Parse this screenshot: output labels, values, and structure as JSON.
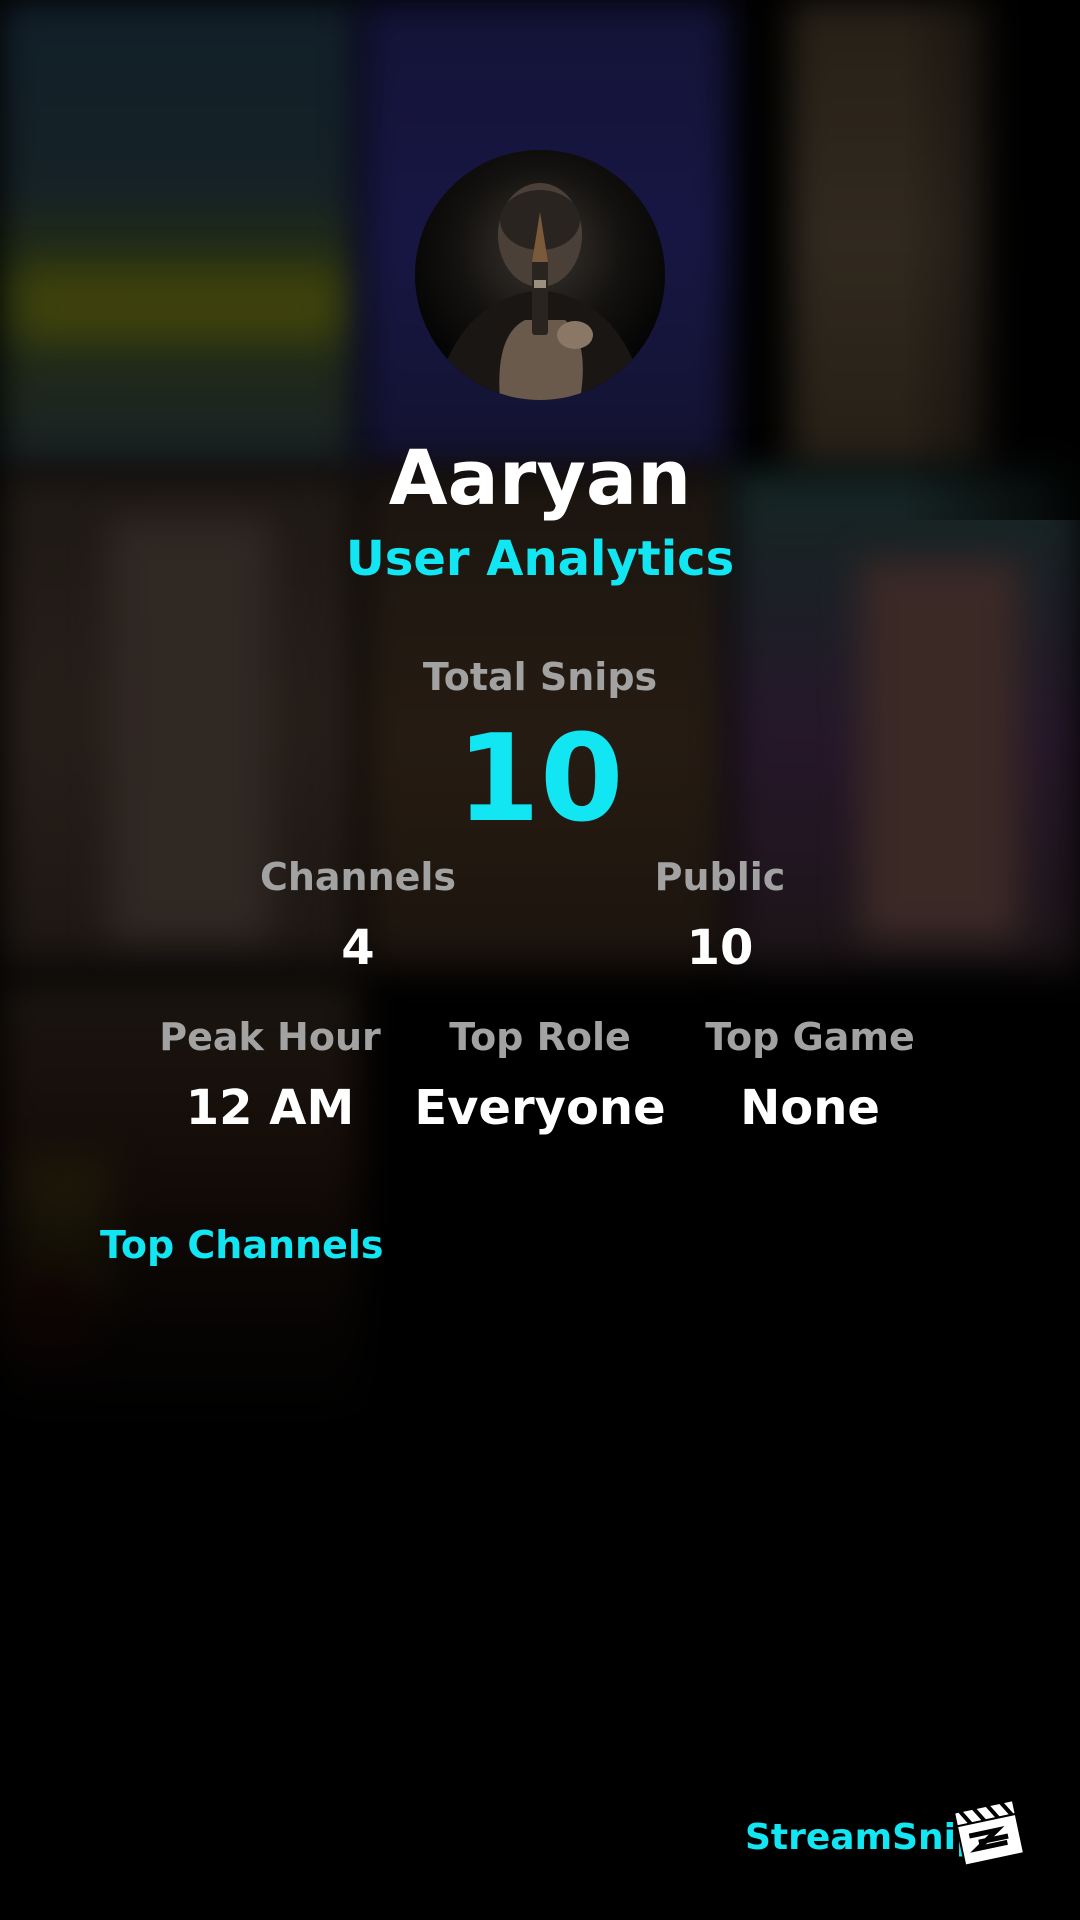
{
  "user": {
    "name": "Aaryan"
  },
  "header": {
    "subtitle": "User Analytics"
  },
  "stats": {
    "total_snips": {
      "label": "Total Snips",
      "value": "10"
    },
    "channels": {
      "label": "Channels",
      "value": "4"
    },
    "public": {
      "label": "Public",
      "value": "10"
    },
    "peak_hour": {
      "label": "Peak Hour",
      "value": "12 AM"
    },
    "top_role": {
      "label": "Top Role",
      "value": "Everyone"
    },
    "top_game": {
      "label": "Top Game",
      "value": "None"
    }
  },
  "sections": {
    "top_channels": "Top Channels"
  },
  "brand": {
    "name": "StreamSnip",
    "icon": "clapperboard-icon"
  },
  "colors": {
    "accent": "#12e6f2",
    "label": "#a2a2a2",
    "background": "#000000"
  }
}
